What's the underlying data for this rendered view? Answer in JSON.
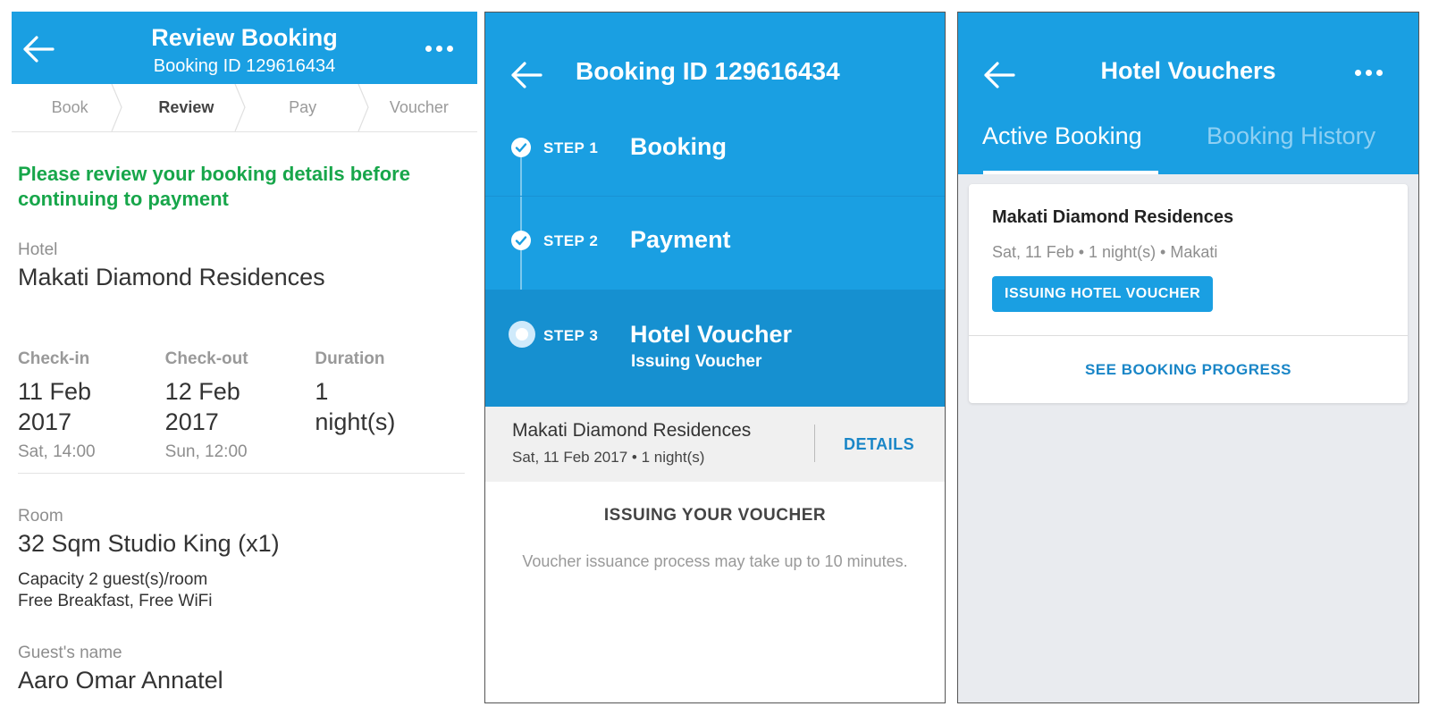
{
  "review": {
    "title": "Review Booking",
    "subtitle": "Booking ID 129616434",
    "steps": [
      "Book",
      "Review",
      "Pay",
      "Voucher"
    ],
    "active_step": "Review",
    "notice": "Please review your booking details before continuing to payment",
    "hotel_label": "Hotel",
    "hotel_name": "Makati Diamond Residences",
    "checkin": {
      "label": "Check-in",
      "date_line1": "11 Feb",
      "date_line2": "2017",
      "time": "Sat, 14:00"
    },
    "checkout": {
      "label": "Check-out",
      "date_line1": "12 Feb",
      "date_line2": "2017",
      "time": "Sun, 12:00"
    },
    "duration": {
      "label": "Duration",
      "line1": "1",
      "line2": "night(s)"
    },
    "room_label": "Room",
    "room_name": "32 Sqm Studio King (x1)",
    "capacity": "Capacity 2 guest(s)/room",
    "amenities": "Free Breakfast, Free WiFi",
    "guest_label": "Guest's name",
    "guest_name": "Aaro Omar Annatel"
  },
  "progress": {
    "title": "Booking ID 129616434",
    "steps": [
      {
        "number": "STEP 1",
        "name": "Booking",
        "status": "done"
      },
      {
        "number": "STEP 2",
        "name": "Payment",
        "status": "done"
      },
      {
        "number": "STEP 3",
        "name": "Hotel Voucher",
        "status": "current",
        "subtitle": "Issuing Voucher"
      }
    ],
    "card": {
      "hotel": "Makati Diamond Residences",
      "meta": "Sat, 11 Feb 2017 • 1 night(s)",
      "details_label": "DETAILS"
    },
    "issuing_title": "ISSUING YOUR VOUCHER",
    "issuing_desc": "Voucher issuance process may take up to 10 minutes."
  },
  "vouchers": {
    "title": "Hotel Vouchers",
    "tabs": [
      "Active Booking",
      "Booking History"
    ],
    "active_tab": "Active Booking",
    "card": {
      "hotel": "Makati Diamond Residences",
      "meta": "Sat, 11 Feb • 1 night(s) • Makati",
      "status": "ISSUING HOTEL VOUCHER",
      "progress_label": "SEE BOOKING PROGRESS"
    }
  },
  "colors": {
    "primary": "#1a9fe2",
    "notice_green": "#17a64a",
    "link_blue": "#1a86c7"
  },
  "icons": [
    "back-arrow-icon",
    "more-dots-icon",
    "check-icon"
  ]
}
